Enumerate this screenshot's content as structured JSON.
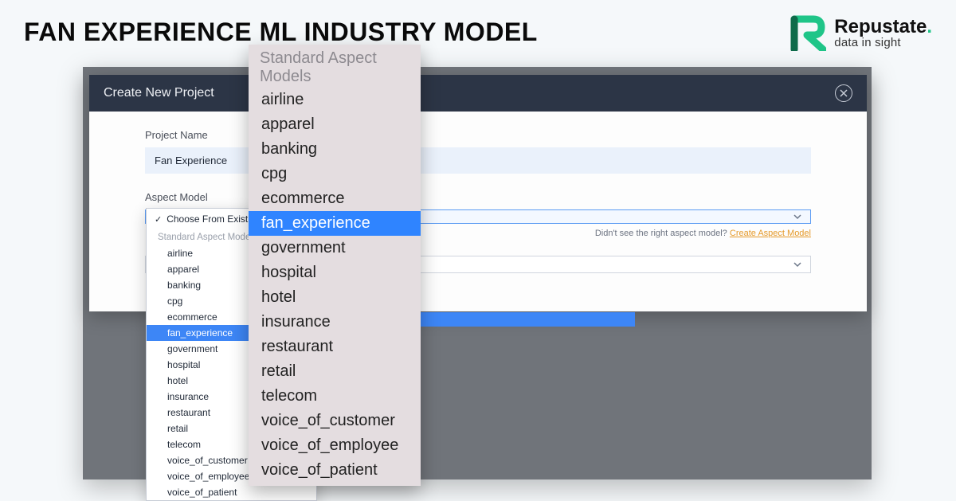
{
  "page": {
    "title": "FAN EXPERIENCE ML INDUSTRY MODEL"
  },
  "logo": {
    "name": "Repustate",
    "tagline": "data in sight"
  },
  "modal": {
    "title": "Create New Project",
    "project_name_label": "Project Name",
    "project_name_value": "Fan Experience",
    "aspect_model_label": "Aspect Model",
    "select_placeholder": "Choose From Existing",
    "hint_text": "Didn't see the right aspect model?",
    "hint_link": "Create Aspect Model"
  },
  "dropdown": {
    "top_option": "Choose From Existing",
    "group_label": "Standard Aspect Models",
    "options": [
      "airline",
      "apparel",
      "banking",
      "cpg",
      "ecommerce",
      "fan_experience",
      "government",
      "hospital",
      "hotel",
      "insurance",
      "restaurant",
      "retail",
      "telecom",
      "voice_of_customer",
      "voice_of_employee",
      "voice_of_patient"
    ],
    "selected": "fan_experience"
  }
}
